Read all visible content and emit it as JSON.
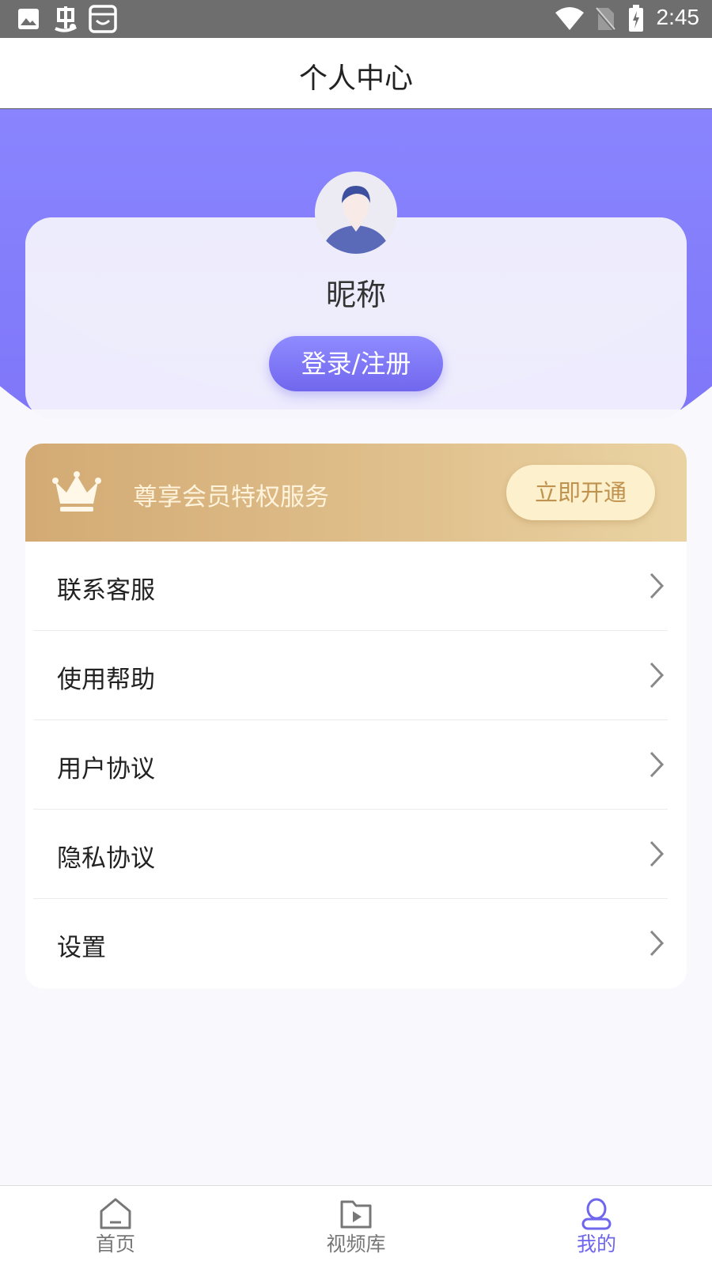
{
  "status_bar": {
    "time": "2:45",
    "icons": [
      "image-icon",
      "bug-icon",
      "store-icon",
      "wifi-icon",
      "no-sim-icon",
      "battery-charging-icon"
    ]
  },
  "header": {
    "title": "个人中心"
  },
  "profile": {
    "avatar_icon": "user-avatar-icon",
    "nickname": "昵称",
    "login_label": "登录/注册"
  },
  "vip": {
    "icon": "crown-icon",
    "text": "尊享会员特权服务",
    "button_label": "立即开通"
  },
  "menu": {
    "items": [
      {
        "label": "联系客服"
      },
      {
        "label": "使用帮助"
      },
      {
        "label": "用户协议"
      },
      {
        "label": "隐私协议"
      },
      {
        "label": "设置"
      }
    ]
  },
  "bottom_nav": {
    "items": [
      {
        "label": "首页",
        "icon": "home-icon"
      },
      {
        "label": "视频库",
        "icon": "video-library-icon"
      },
      {
        "label": "我的",
        "icon": "profile-icon",
        "active": true
      }
    ]
  },
  "colors": {
    "accent": "#6f66ee",
    "hero_purple": "#8b87ff",
    "vip_gold": "#d3aa74",
    "vip_button_bg": "#fdf0cc"
  }
}
